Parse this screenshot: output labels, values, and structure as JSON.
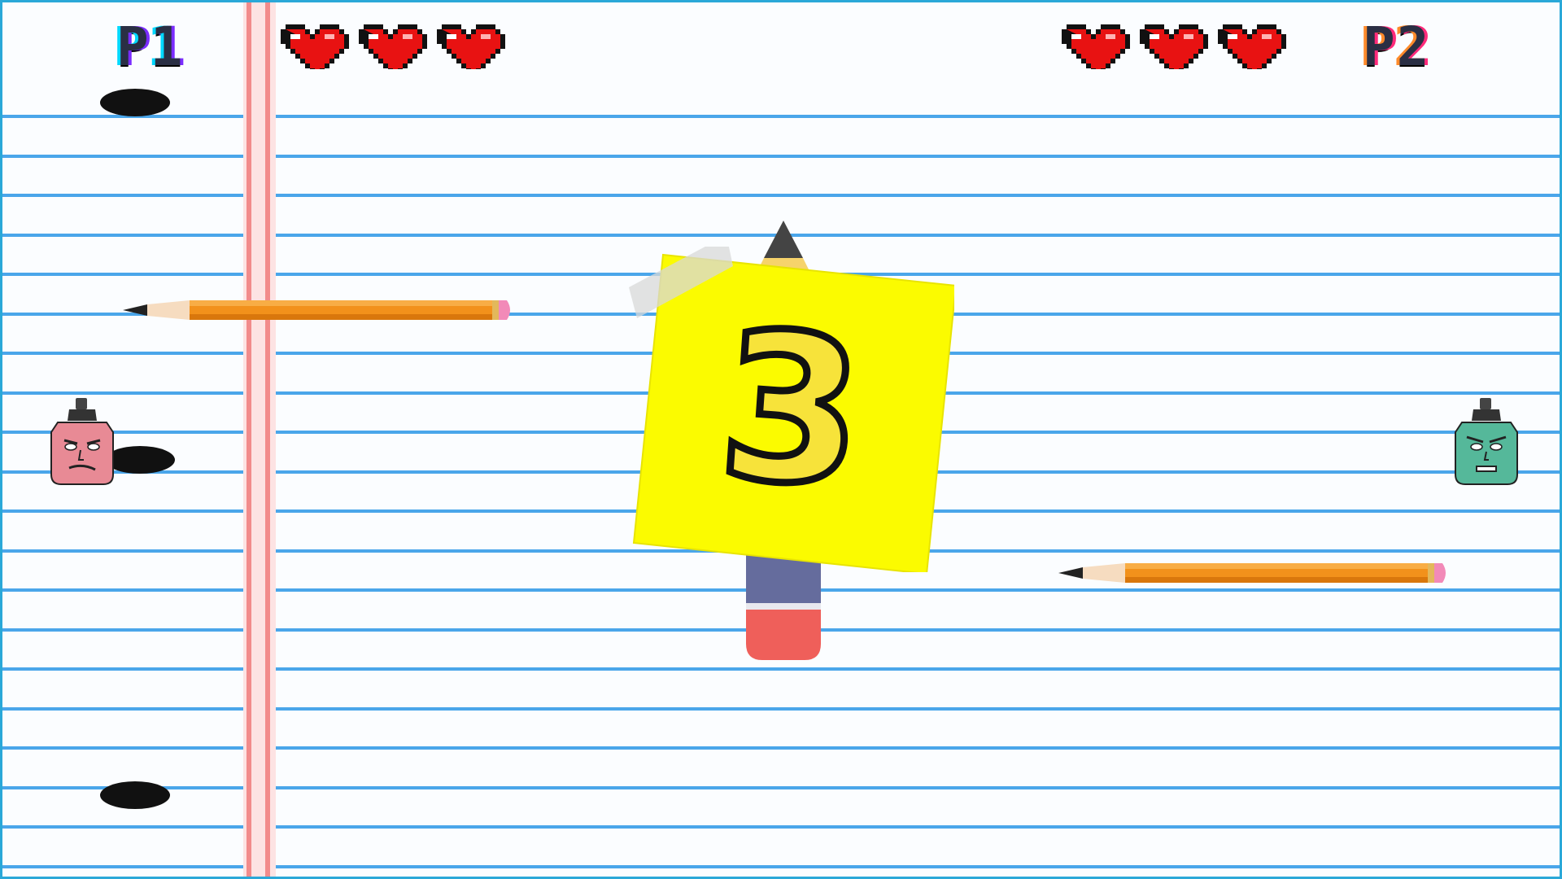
{
  "hud": {
    "p1_label": "P1",
    "p2_label": "P2",
    "p1_hearts": 3,
    "p2_hearts": 3
  },
  "countdown": "3",
  "icons": {
    "heart": "heart-icon",
    "hole": "binder-hole",
    "pencil": "pencil-paddle",
    "highlighter_p1": "pink-highlighter-face",
    "highlighter_p2": "green-highlighter-face",
    "sticky_note": "sticky-note"
  },
  "colors": {
    "paper": "#fbfdff",
    "rule_line": "#4aa6ea",
    "margin_line": "#f28b8b",
    "heart": "#e81212",
    "sticky": "#fbfb00",
    "pencil_body": "#f2911b",
    "p1_highlighter": "#e88a95",
    "p2_highlighter": "#55b89a",
    "border": "#2aa8d8"
  }
}
